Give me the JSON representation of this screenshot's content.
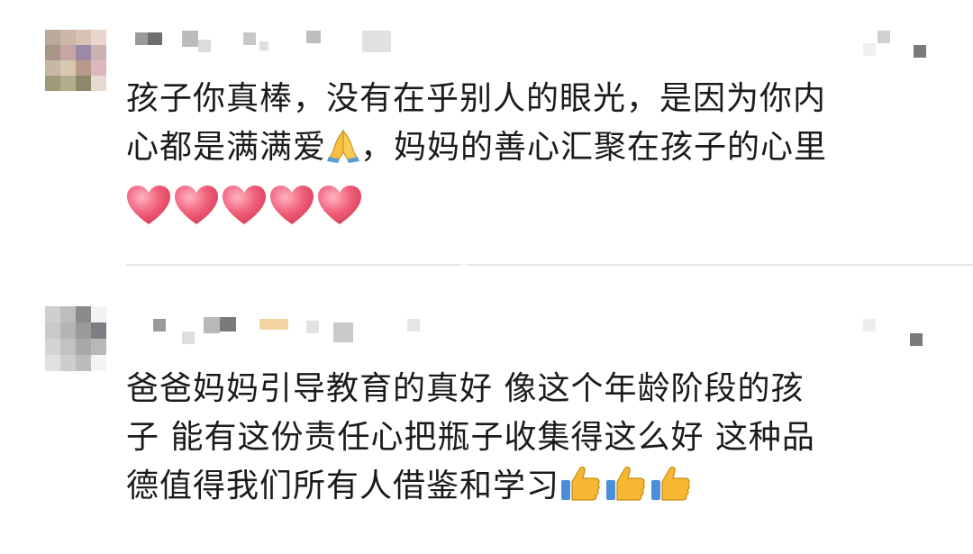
{
  "comments": [
    {
      "text_line1": "孩子你真棒，没有在乎别人的眼光，是因为你内",
      "text_line2_a": "心都是满满爱",
      "text_line2_b": "，妈妈的善心汇聚在孩子的心里",
      "emojis": [
        "folded-hands",
        "heart",
        "heart",
        "heart",
        "heart",
        "heart"
      ]
    },
    {
      "text_line1": "爸爸妈妈引导教育的真好  像这个年龄阶段的孩",
      "text_line2": "子 能有这份责任心把瓶子收集得这么好 这种品",
      "text_line3": "德值得我们所有人借鉴和学习",
      "emojis": [
        "thumbs-up",
        "thumbs-up",
        "thumbs-up"
      ]
    }
  ],
  "colors": {
    "background": "#ffffff",
    "text": "#1b1b1b",
    "divider": "#e6e6e6",
    "heart": "#f0607a",
    "thumb": "#f6b733"
  }
}
